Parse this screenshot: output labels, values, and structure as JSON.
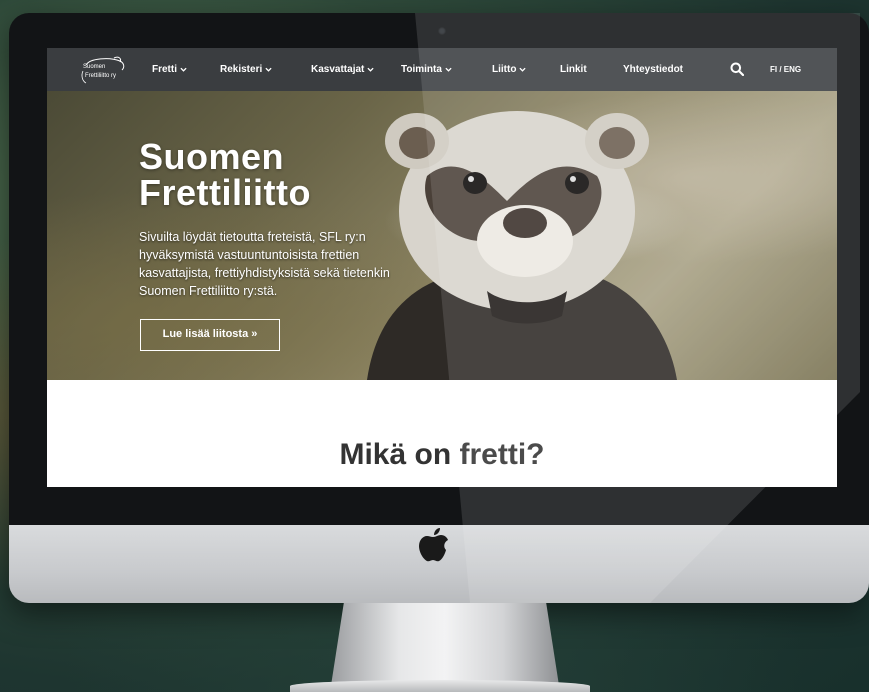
{
  "nav": {
    "logo_alt": "Suomen Frettiliitto ry",
    "items": [
      {
        "label": "Fretti",
        "dropdown": true
      },
      {
        "label": "Rekisteri",
        "dropdown": true
      },
      {
        "label": "Kasvattajat",
        "dropdown": true
      },
      {
        "label": "Toiminta",
        "dropdown": true
      },
      {
        "label": "Liitto",
        "dropdown": true
      },
      {
        "label": "Linkit",
        "dropdown": false
      },
      {
        "label": "Yhteystiedot",
        "dropdown": false
      }
    ],
    "search_icon": "search-icon",
    "language": "FI / ENG"
  },
  "hero": {
    "title_line1": "Suomen",
    "title_line2": "Frettiliitto",
    "text": "Sivuilta löydät tietoutta freteistä, SFL ry:n hyväksymistä vastuuntuntoisista frettien kasvattajista, frettiyhdistyksistä sekä tietenkin Suomen Frettiliitto ry:stä.",
    "button_label": "Lue lisää liitosta  »"
  },
  "section": {
    "title": "Mikä on fretti?"
  },
  "colors": {
    "navbar": "#3a3d40",
    "bezel": "#121416",
    "chin": "#c8cacd",
    "heading": "#333333"
  }
}
